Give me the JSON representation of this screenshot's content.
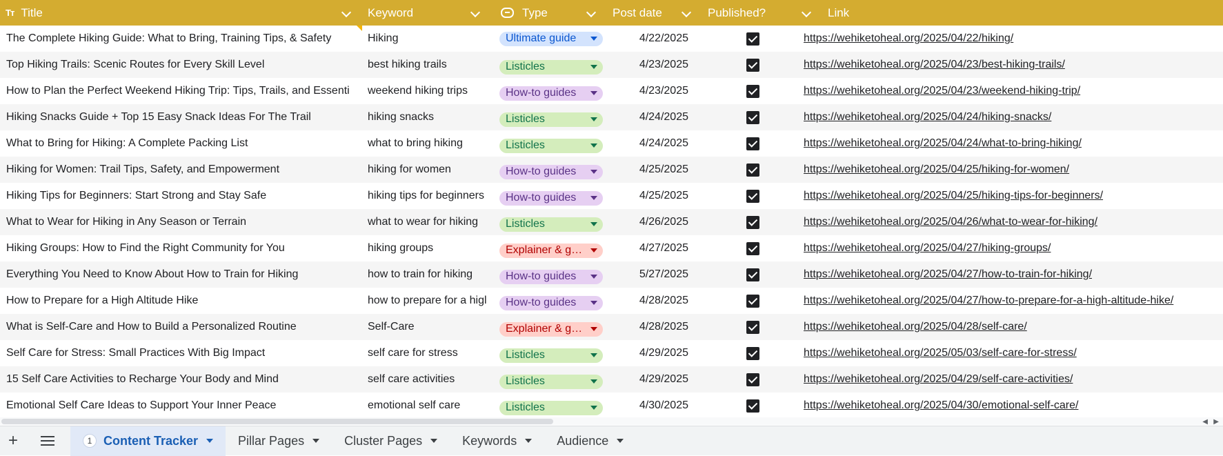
{
  "columns": {
    "title": "Title",
    "keyword": "Keyword",
    "type": "Type",
    "post_date": "Post date",
    "published": "Published?",
    "link": "Link"
  },
  "colors": {
    "header_bg": "#d4ac30",
    "chip_ultimate": {
      "bg": "#d3e3fd",
      "fg": "#0b57d0"
    },
    "chip_listicles": {
      "bg": "#d4edbc",
      "fg": "#11734b"
    },
    "chip_howto": {
      "bg": "#e6cff2",
      "fg": "#5a3286"
    },
    "chip_explainer": {
      "bg": "#ffcfc9",
      "fg": "#b10202"
    }
  },
  "rows": [
    {
      "title": "The Complete Hiking Guide: What to Bring, Training Tips, & Safety",
      "keyword": "Hiking",
      "type": "Ultimate guide",
      "type_style": "ultimate",
      "date": "4/22/2025",
      "published": true,
      "link": "https://wehiketoheal.org/2025/04/22/hiking/"
    },
    {
      "title": "Top Hiking Trails: Scenic Routes for Every Skill Level",
      "keyword": "best hiking trails",
      "type": "Listicles",
      "type_style": "listicles",
      "date": "4/23/2025",
      "published": true,
      "link": "https://wehiketoheal.org/2025/04/23/best-hiking-trails/"
    },
    {
      "title": "How to Plan the Perfect Weekend Hiking Trip: Tips, Trails, and Essenti",
      "keyword": "weekend hiking trips",
      "type": "How-to guides",
      "type_style": "howto",
      "date": "4/23/2025",
      "published": true,
      "link": "https://wehiketoheal.org/2025/04/23/weekend-hiking-trip/"
    },
    {
      "title": "Hiking Snacks Guide + Top 15 Easy Snack Ideas For The Trail",
      "keyword": "hiking snacks",
      "type": "Listicles",
      "type_style": "listicles",
      "date": "4/24/2025",
      "published": true,
      "link": "https://wehiketoheal.org/2025/04/24/hiking-snacks/"
    },
    {
      "title": "What to Bring for Hiking: A Complete Packing List",
      "keyword": "what to bring hiking",
      "type": "Listicles",
      "type_style": "listicles",
      "date": "4/24/2025",
      "published": true,
      "link": "https://wehiketoheal.org/2025/04/24/what-to-bring-hiking/"
    },
    {
      "title": "Hiking for Women: Trail Tips, Safety, and Empowerment",
      "keyword": "hiking for women",
      "type": "How-to guides",
      "type_style": "howto",
      "date": "4/25/2025",
      "published": true,
      "link": "https://wehiketoheal.org/2025/04/25/hiking-for-women/"
    },
    {
      "title": "Hiking Tips for Beginners: Start Strong and Stay Safe",
      "keyword": "hiking tips for beginners",
      "type": "How-to guides",
      "type_style": "howto",
      "date": "4/25/2025",
      "published": true,
      "link": "https://wehiketoheal.org/2025/04/25/hiking-tips-for-beginners/"
    },
    {
      "title": "What to Wear for Hiking in Any Season or Terrain",
      "keyword": "what to wear for hiking",
      "type": "Listicles",
      "type_style": "listicles",
      "date": "4/26/2025",
      "published": true,
      "link": "https://wehiketoheal.org/2025/04/26/what-to-wear-for-hiking/"
    },
    {
      "title": "Hiking Groups: How to Find the Right Community for You",
      "keyword": "hiking groups",
      "type": "Explainer & g…",
      "type_style": "explainer",
      "date": "4/27/2025",
      "published": true,
      "link": "https://wehiketoheal.org/2025/04/27/hiking-groups/"
    },
    {
      "title": "Everything You Need to Know About How to Train for Hiking",
      "keyword": "how to train for hiking",
      "type": "How-to guides",
      "type_style": "howto",
      "date": "5/27/2025",
      "published": true,
      "link": "https://wehiketoheal.org/2025/04/27/how-to-train-for-hiking/"
    },
    {
      "title": "How to Prepare for a High Altitude Hike",
      "keyword": "how to prepare for a higl",
      "type": "How-to guides",
      "type_style": "howto",
      "date": "4/28/2025",
      "published": true,
      "link": "https://wehiketoheal.org/2025/04/27/how-to-prepare-for-a-high-altitude-hike/"
    },
    {
      "title": "What is Self-Care and How to Build a Personalized Routine",
      "keyword": "Self-Care",
      "type": "Explainer & gu…",
      "type_style": "explainer",
      "date": "4/28/2025",
      "published": true,
      "link": "https://wehiketoheal.org/2025/04/28/self-care/"
    },
    {
      "title": "Self Care for Stress: Small Practices With Big Impact",
      "keyword": "self care for stress",
      "type": "Listicles",
      "type_style": "listicles",
      "date": "4/29/2025",
      "published": true,
      "link": "https://wehiketoheal.org/2025/05/03/self-care-for-stress/"
    },
    {
      "title": "15 Self Care Activities to Recharge Your Body and Mind",
      "keyword": "self care activities",
      "type": "Listicles",
      "type_style": "listicles",
      "date": "4/29/2025",
      "published": true,
      "link": "https://wehiketoheal.org/2025/04/29/self-care-activities/"
    },
    {
      "title": "Emotional Self Care Ideas to Support Your Inner Peace",
      "keyword": "emotional self care",
      "type": "Listicles",
      "type_style": "listicles",
      "date": "4/30/2025",
      "published": true,
      "link": "https://wehiketoheal.org/2025/04/30/emotional-self-care/"
    }
  ],
  "sheet_tabs": [
    {
      "label": "Content Tracker",
      "badge": "1",
      "active": true
    },
    {
      "label": "Pillar Pages",
      "active": false
    },
    {
      "label": "Cluster Pages",
      "active": false
    },
    {
      "label": "Keywords",
      "active": false
    },
    {
      "label": "Audience",
      "active": false
    }
  ],
  "toolbar": {
    "add_sheet_icon": "plus-icon",
    "all_sheets_icon": "menu-icon"
  }
}
